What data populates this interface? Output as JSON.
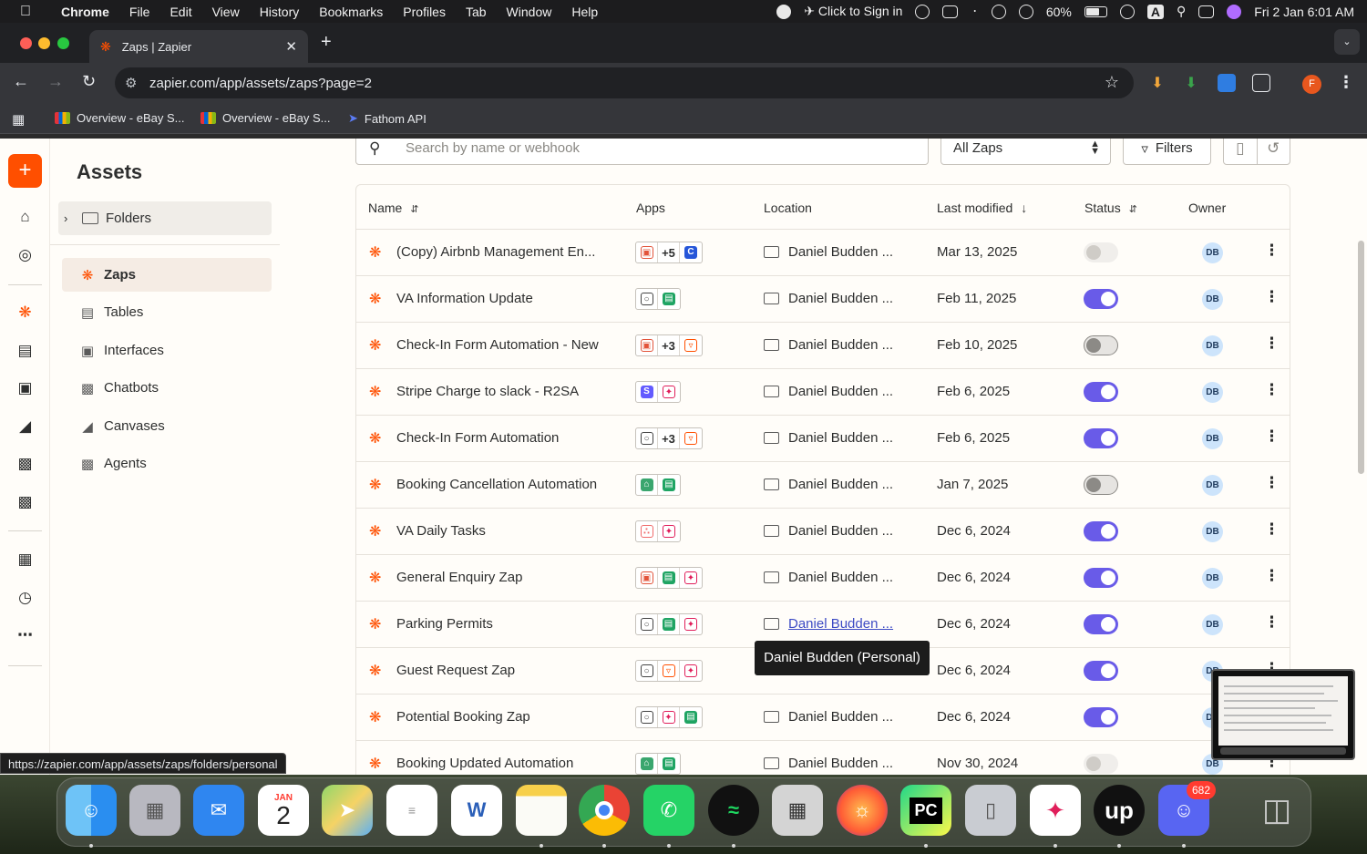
{
  "menubar": {
    "app": "Chrome",
    "items": [
      "File",
      "Edit",
      "View",
      "History",
      "Bookmarks",
      "Profiles",
      "Tab",
      "Window",
      "Help"
    ],
    "sign_in": "Click to Sign in",
    "battery": "60%",
    "input_source": "A",
    "clock": "Fri 2 Jan  6:01 AM"
  },
  "browser": {
    "tab_title": "Zaps | Zapier",
    "url": "zapier.com/app/assets/zaps?page=2",
    "profile_initial": "F",
    "bookmarks": [
      "Overview - eBay S...",
      "Overview - eBay S...",
      "Fathom API"
    ],
    "status_url": "https://zapier.com/app/assets/zaps/folders/personal"
  },
  "sidebar": {
    "title": "Assets",
    "folders_label": "Folders",
    "items": [
      {
        "label": "Zaps",
        "icon": "bolt-icon"
      },
      {
        "label": "Tables",
        "icon": "tables-icon"
      },
      {
        "label": "Interfaces",
        "icon": "interfaces-icon"
      },
      {
        "label": "Chatbots",
        "icon": "chatbots-icon"
      },
      {
        "label": "Canvases",
        "icon": "canvases-icon"
      },
      {
        "label": "Agents",
        "icon": "agents-icon"
      }
    ]
  },
  "toolbar": {
    "search_placeholder": "Search by name or webhook",
    "filter_select": "All Zaps",
    "filters_label": "Filters"
  },
  "table": {
    "headers": {
      "name": "Name",
      "apps": "Apps",
      "location": "Location",
      "last_modified": "Last modified",
      "status": "Status",
      "owner": "Owner"
    },
    "rows": [
      {
        "name": "(Copy) Airbnb Management En...",
        "apps": [
          "hospitable",
          "+5",
          "c-app"
        ],
        "location": "Daniel Budden ...",
        "modified": "Mar 13, 2025",
        "status": "disabled",
        "owner": "DB"
      },
      {
        "name": "VA Information Update",
        "apps": [
          "form",
          "sheets"
        ],
        "location": "Daniel Budden ...",
        "modified": "Feb 11, 2025",
        "status": "on",
        "owner": "DB"
      },
      {
        "name": "Check-In Form Automation - New",
        "apps": [
          "hospitable",
          "+3",
          "filter"
        ],
        "location": "Daniel Budden ...",
        "modified": "Feb 10, 2025",
        "status": "off",
        "owner": "DB"
      },
      {
        "name": "Stripe Charge to slack - R2SA",
        "apps": [
          "stripe",
          "slack"
        ],
        "location": "Daniel Budden ...",
        "modified": "Feb 6, 2025",
        "status": "on",
        "owner": "DB"
      },
      {
        "name": "Check-In Form Automation",
        "apps": [
          "form",
          "+3",
          "filter"
        ],
        "location": "Daniel Budden ...",
        "modified": "Feb 6, 2025",
        "status": "on",
        "owner": "DB"
      },
      {
        "name": "Booking Cancellation Automation",
        "apps": [
          "house",
          "sheets"
        ],
        "location": "Daniel Budden ...",
        "modified": "Jan 7, 2025",
        "status": "off",
        "owner": "DB"
      },
      {
        "name": "VA Daily Tasks",
        "apps": [
          "asana",
          "slack"
        ],
        "location": "Daniel Budden ...",
        "modified": "Dec 6, 2024",
        "status": "on",
        "owner": "DB"
      },
      {
        "name": "General Enquiry Zap",
        "apps": [
          "hospitable",
          "sheets",
          "slack"
        ],
        "location": "Daniel Budden ...",
        "modified": "Dec 6, 2024",
        "status": "on",
        "owner": "DB"
      },
      {
        "name": "Parking Permits",
        "apps": [
          "form",
          "sheets",
          "slack"
        ],
        "location": "Daniel Budden ...",
        "modified": "Dec 6, 2024",
        "status": "on",
        "owner": "DB",
        "hover": true
      },
      {
        "name": "Guest Request Zap",
        "apps": [
          "form",
          "filter",
          "slack"
        ],
        "location": "",
        "modified": "Dec 6, 2024",
        "status": "on",
        "owner": "DB"
      },
      {
        "name": "Potential Booking Zap",
        "apps": [
          "form",
          "slack",
          "sheets"
        ],
        "location": "Daniel Budden ...",
        "modified": "Dec 6, 2024",
        "status": "on",
        "owner": "DB"
      },
      {
        "name": "Booking Updated Automation",
        "apps": [
          "house",
          "sheets"
        ],
        "location": "Daniel Budden ...",
        "modified": "Nov 30, 2024",
        "status": "disabled",
        "owner": "DB"
      }
    ],
    "tooltip": "Daniel Budden (Personal)"
  },
  "dock": {
    "calendar_month": "JAN",
    "calendar_day": "2",
    "discord_badge": "682",
    "pycharm_label": "PC",
    "upwork_label": "up"
  },
  "colors": {
    "zapier_orange": "#ff4f00",
    "toggle_on": "#695be8"
  }
}
